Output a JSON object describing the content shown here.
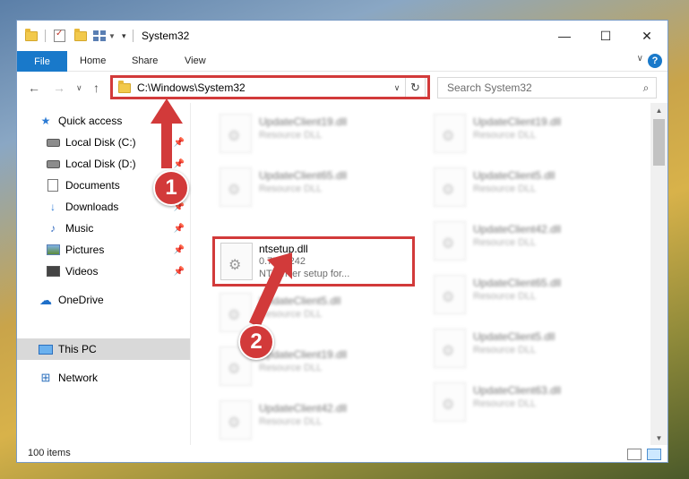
{
  "window": {
    "title": "System32",
    "minimize": "—",
    "maximize": "☐",
    "close": "✕"
  },
  "ribbon": {
    "tabs": [
      "File",
      "Home",
      "Share",
      "View"
    ],
    "help": "?",
    "collapse": "∨"
  },
  "nav": {
    "back": "←",
    "forward": "→",
    "recent": "∨",
    "up": "↑"
  },
  "address": {
    "path": "C:\\Windows\\System32",
    "chevron": "∨",
    "refresh": "↻"
  },
  "search": {
    "placeholder": "Search System32",
    "icon": "search-icon"
  },
  "sidebar": {
    "items": [
      {
        "label": "Quick access",
        "icon": "star-icon"
      },
      {
        "label": "Local Disk (C:)",
        "icon": "disk-icon",
        "pinned": true
      },
      {
        "label": "Local Disk (D:)",
        "icon": "disk-icon",
        "pinned": true
      },
      {
        "label": "Documents",
        "icon": "document-icon",
        "pinned": true
      },
      {
        "label": "Downloads",
        "icon": "download-icon",
        "pinned": true
      },
      {
        "label": "Music",
        "icon": "music-icon",
        "pinned": true
      },
      {
        "label": "Pictures",
        "icon": "pictures-icon",
        "pinned": true
      },
      {
        "label": "Videos",
        "icon": "videos-icon",
        "pinned": true
      },
      {
        "label": "OneDrive",
        "icon": "cloud-icon"
      },
      {
        "label": "This PC",
        "icon": "computer-icon",
        "selected": true
      },
      {
        "label": "Network",
        "icon": "network-icon"
      }
    ]
  },
  "files": {
    "left": [
      {
        "name": "UpdateClient19.dll",
        "desc": "Resource DLL"
      },
      {
        "name": "UpdateClient65.dll",
        "desc": "Resource DLL"
      },
      {
        "name": "ntsetup.dll",
        "version": "0.75.0.242",
        "desc": "NT Driver setup for...",
        "highlighted": true
      },
      {
        "name": "UpdateClient5.dll",
        "desc": "Resource DLL"
      },
      {
        "name": "UpdateClient19.dll",
        "desc": "Resource DLL"
      },
      {
        "name": "UpdateClient42.dll",
        "desc": "Resource DLL"
      }
    ],
    "right": [
      {
        "name": "UpdateClient19.dll",
        "desc": "Resource DLL"
      },
      {
        "name": "UpdateClient5.dll",
        "desc": "Resource DLL"
      },
      {
        "name": "UpdateClient42.dll",
        "desc": "Resource DLL"
      },
      {
        "name": "UpdateClient65.dll",
        "desc": "Resource DLL"
      },
      {
        "name": "UpdateClient5.dll",
        "desc": "Resource DLL"
      },
      {
        "name": "UpdateClient63.dll",
        "desc": "Resource DLL"
      }
    ]
  },
  "status": {
    "count": "100 items"
  },
  "annotations": {
    "marker1": "1",
    "marker2": "2",
    "color": "#d23a3a"
  },
  "colors": {
    "accent": "#1979ca"
  }
}
